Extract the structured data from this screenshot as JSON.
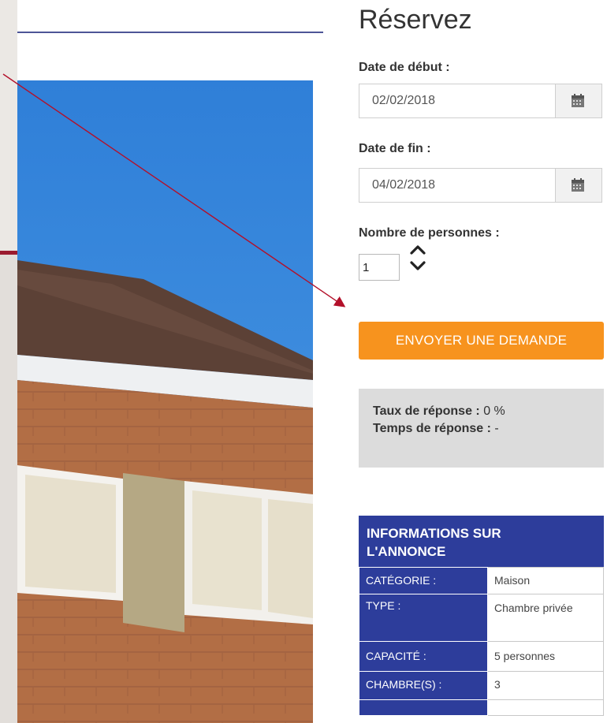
{
  "booking": {
    "title": "Réservez",
    "start_label": "Date de début :",
    "start_value": "02/02/2018",
    "end_label": "Date de fin :",
    "end_value": "04/02/2018",
    "persons_label": "Nombre de personnes :",
    "persons_value": "1",
    "send_button": "ENVOYER UNE DEMANDE"
  },
  "stats": {
    "rate_label": "Taux de réponse :",
    "rate_value": "0 %",
    "time_label": "Temps de réponse :",
    "time_value": "-"
  },
  "info": {
    "heading_line1": "INFORMATIONS SUR",
    "heading_line2": "L'ANNONCE",
    "rows": [
      {
        "key": "CATÉGORIE :",
        "value": "Maison"
      },
      {
        "key": "TYPE :",
        "value": "Chambre privée"
      },
      {
        "key": "CAPACITÉ :",
        "value": "5 personnes"
      },
      {
        "key": "CHAMBRE(S) :",
        "value": "3"
      }
    ]
  },
  "colors": {
    "accent_orange": "#f7931e",
    "info_blue": "#2d3d9b",
    "annotation_red": "#b3102a"
  },
  "icons": [
    "calendar-icon",
    "chevron-up-icon",
    "chevron-down-icon"
  ]
}
